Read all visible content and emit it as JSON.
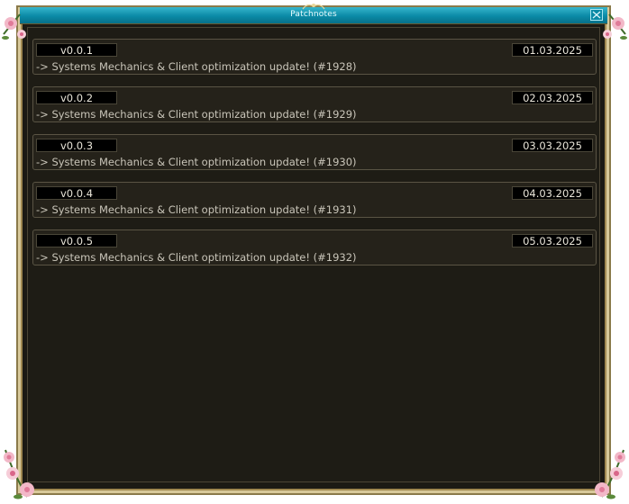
{
  "window": {
    "title": "Patchnotes",
    "close_icon": "close-icon"
  },
  "entries": [
    {
      "version": "v0.0.1",
      "date": "01.03.2025",
      "text": "-> Systems Mechanics & Client optimization update! (#1928)"
    },
    {
      "version": "v0.0.2",
      "date": "02.03.2025",
      "text": "-> Systems Mechanics & Client optimization update! (#1929)"
    },
    {
      "version": "v0.0.3",
      "date": "03.03.2025",
      "text": "-> Systems Mechanics & Client optimization update! (#1930)"
    },
    {
      "version": "v0.0.4",
      "date": "04.03.2025",
      "text": "-> Systems Mechanics & Client optimization update! (#1931)"
    },
    {
      "version": "v0.0.5",
      "date": "05.03.2025",
      "text": "-> Systems Mechanics & Client optimization update! (#1932)"
    }
  ],
  "colors": {
    "titlebar": "#0b8aa6",
    "frame_gold": "#d8c99a",
    "panel_bg": "#1e1c15",
    "text": "#e8e4d8"
  },
  "icons": {
    "corner_decoration": "flower-icon",
    "crest": "crest-icon"
  }
}
